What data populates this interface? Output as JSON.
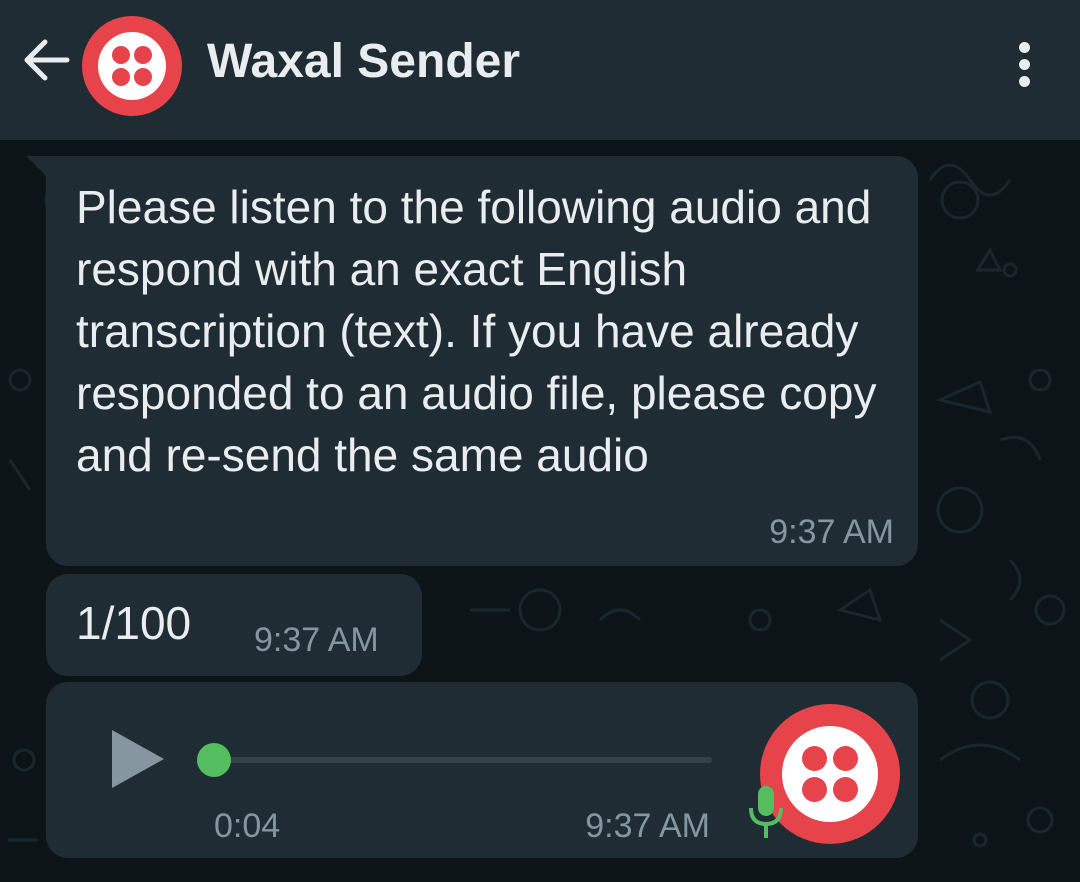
{
  "header": {
    "title": "Waxal Sender",
    "back_icon": "arrow-left-icon",
    "menu_icon": "more-vertical-icon",
    "avatar_icon": "twilio-logo-icon"
  },
  "messages": [
    {
      "text": "Please listen to the following audio and respond with an exact English transcription (text). If you have already responded to an audio file, please copy and re-send the same audio",
      "time": "9:37 AM"
    },
    {
      "text": "1/100",
      "time": "9:37 AM"
    }
  ],
  "voice_message": {
    "duration": "0:04",
    "time": "9:37 AM",
    "progress": 0,
    "play_icon": "play-icon",
    "mic_icon": "microphone-icon"
  },
  "colors": {
    "header_bg": "#1f2c33",
    "bubble_bg": "#1f2c33",
    "chat_bg": "#0d1418",
    "brand_red": "#e7434b",
    "accent_green": "#53bd5f",
    "text_primary": "#e9edef",
    "text_secondary": "#8696a0"
  }
}
